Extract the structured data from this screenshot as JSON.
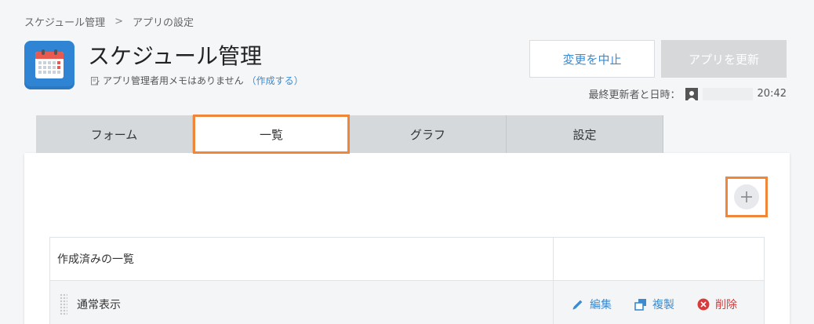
{
  "breadcrumb": {
    "item1": "スケジュール管理",
    "separator": ">",
    "item2": "アプリの設定"
  },
  "app": {
    "title": "スケジュール管理",
    "memo_text": "アプリ管理者用メモはありません",
    "memo_link_open": "（",
    "memo_link": "作成する",
    "memo_link_close": "）",
    "icon": "calendar-icon",
    "icon_color": "#2f84d4"
  },
  "actions": {
    "cancel": "変更を中止",
    "update": "アプリを更新"
  },
  "updated": {
    "label": "最終更新者と日時：",
    "time": "20:42"
  },
  "tabs": [
    {
      "label": "フォーム"
    },
    {
      "label": "一覧"
    },
    {
      "label": "グラフ"
    },
    {
      "label": "設定"
    }
  ],
  "active_tab": "一覧",
  "highlight_color": "#f0863a",
  "list": {
    "header": "作成済みの一覧",
    "rows": [
      {
        "name": "通常表示",
        "edit": "編集",
        "copy": "複製",
        "delete": "削除"
      }
    ]
  },
  "add_button": {
    "icon": "plus-icon"
  }
}
